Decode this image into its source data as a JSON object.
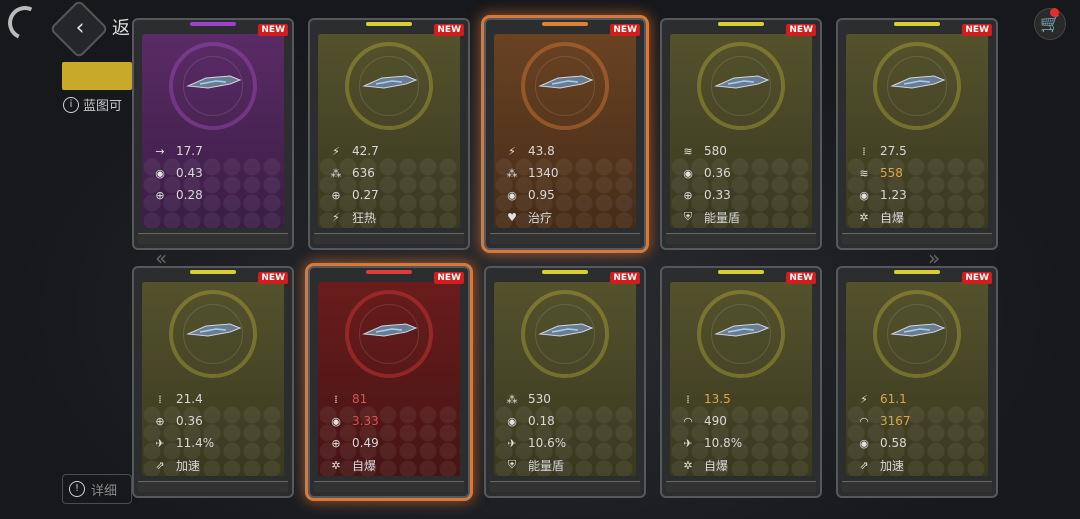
{
  "header": {
    "title": "返"
  },
  "info_text": "蓝图可",
  "bottom_info": "详细",
  "badge_label": "NEW",
  "cards": [
    {
      "tier": "purple",
      "selected": false,
      "stats": [
        {
          "icon": "speed-icon",
          "glyph": "→",
          "value": "17.7",
          "style": ""
        },
        {
          "icon": "fire-rate-icon",
          "glyph": "◉",
          "value": "0.43",
          "style": ""
        },
        {
          "icon": "accuracy-icon",
          "glyph": "⊕",
          "value": "0.28",
          "style": ""
        }
      ]
    },
    {
      "tier": "yellow",
      "selected": false,
      "stats": [
        {
          "icon": "damage-icon",
          "glyph": "⚡",
          "value": "42.7",
          "style": ""
        },
        {
          "icon": "cluster-icon",
          "glyph": "⁂",
          "value": "636",
          "style": ""
        },
        {
          "icon": "accuracy-icon",
          "glyph": "⊕",
          "value": "0.27",
          "style": ""
        },
        {
          "icon": "frenzy-icon",
          "glyph": "⚡",
          "value": "狂热",
          "style": ""
        }
      ]
    },
    {
      "tier": "orange",
      "selected": true,
      "stats": [
        {
          "icon": "damage-icon",
          "glyph": "⚡",
          "value": "43.8",
          "style": ""
        },
        {
          "icon": "cluster-icon",
          "glyph": "⁂",
          "value": "1340",
          "style": ""
        },
        {
          "icon": "fire-rate-icon",
          "glyph": "◉",
          "value": "0.95",
          "style": ""
        },
        {
          "icon": "heal-icon",
          "glyph": "♥",
          "value": "治疗",
          "style": ""
        }
      ]
    },
    {
      "tier": "yellow",
      "selected": false,
      "stats": [
        {
          "icon": "spread-icon",
          "glyph": "≋",
          "value": "580",
          "style": ""
        },
        {
          "icon": "fire-rate-icon",
          "glyph": "◉",
          "value": "0.36",
          "style": ""
        },
        {
          "icon": "accuracy-icon",
          "glyph": "⊕",
          "value": "0.33",
          "style": ""
        },
        {
          "icon": "shield-icon",
          "glyph": "⛨",
          "value": "能量盾",
          "style": ""
        }
      ]
    },
    {
      "tier": "yellow",
      "selected": false,
      "stats": [
        {
          "icon": "ammo-icon",
          "glyph": "⁞",
          "value": "27.5",
          "style": ""
        },
        {
          "icon": "spread-icon",
          "glyph": "≋",
          "value": "558",
          "style": "hl"
        },
        {
          "icon": "fire-rate-icon",
          "glyph": "◉",
          "value": "1.23",
          "style": ""
        },
        {
          "icon": "self-destruct-icon",
          "glyph": "✲",
          "value": "自爆",
          "style": ""
        }
      ]
    },
    {
      "tier": "yellow",
      "selected": false,
      "stats": [
        {
          "icon": "ammo-icon",
          "glyph": "⁞",
          "value": "21.4",
          "style": ""
        },
        {
          "icon": "accuracy-icon",
          "glyph": "⊕",
          "value": "0.36",
          "style": ""
        },
        {
          "icon": "missile-icon",
          "glyph": "✈",
          "value": "11.4%",
          "style": ""
        },
        {
          "icon": "boost-icon",
          "glyph": "⇗",
          "value": "加速",
          "style": ""
        }
      ]
    },
    {
      "tier": "red",
      "selected": true,
      "stats": [
        {
          "icon": "ammo-icon",
          "glyph": "⁞",
          "value": "81",
          "style": "red"
        },
        {
          "icon": "fire-rate-icon",
          "glyph": "◉",
          "value": "3.33",
          "style": "red"
        },
        {
          "icon": "accuracy-icon",
          "glyph": "⊕",
          "value": "0.49",
          "style": ""
        },
        {
          "icon": "self-destruct-icon",
          "glyph": "✲",
          "value": "自爆",
          "style": ""
        }
      ]
    },
    {
      "tier": "yellow",
      "selected": false,
      "stats": [
        {
          "icon": "cluster-icon",
          "glyph": "⁂",
          "value": "530",
          "style": ""
        },
        {
          "icon": "fire-rate-icon",
          "glyph": "◉",
          "value": "0.18",
          "style": ""
        },
        {
          "icon": "missile-icon",
          "glyph": "✈",
          "value": "10.6%",
          "style": ""
        },
        {
          "icon": "shield-icon",
          "glyph": "⛨",
          "value": "能量盾",
          "style": ""
        }
      ]
    },
    {
      "tier": "yellow",
      "selected": false,
      "stats": [
        {
          "icon": "ammo-icon",
          "glyph": "⁞",
          "value": "13.5",
          "style": "hl"
        },
        {
          "icon": "dome-icon",
          "glyph": "◠",
          "value": "490",
          "style": ""
        },
        {
          "icon": "missile-icon",
          "glyph": "✈",
          "value": "10.8%",
          "style": ""
        },
        {
          "icon": "self-destruct-icon",
          "glyph": "✲",
          "value": "自爆",
          "style": ""
        }
      ]
    },
    {
      "tier": "yellow",
      "selected": false,
      "stats": [
        {
          "icon": "damage-icon",
          "glyph": "⚡",
          "value": "61.1",
          "style": "hl"
        },
        {
          "icon": "dome-icon",
          "glyph": "◠",
          "value": "3167",
          "style": "hl"
        },
        {
          "icon": "fire-rate-icon",
          "glyph": "◉",
          "value": "0.58",
          "style": ""
        },
        {
          "icon": "boost-icon",
          "glyph": "⇗",
          "value": "加速",
          "style": ""
        }
      ]
    }
  ]
}
